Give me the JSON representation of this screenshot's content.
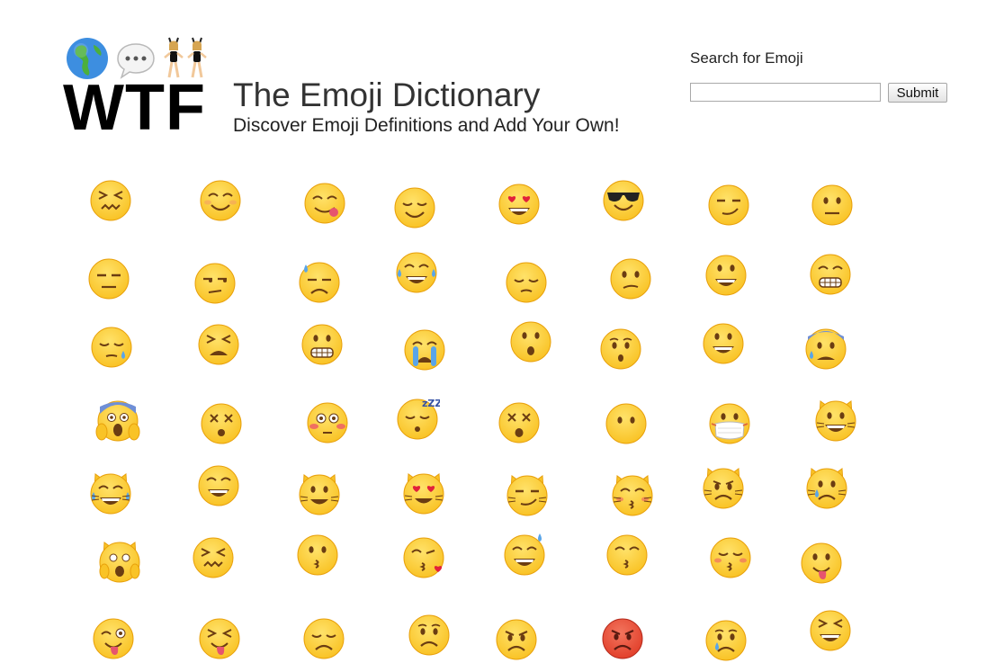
{
  "header": {
    "logo_text": "WTF",
    "logo_icons": [
      "globe-icon",
      "speech-bubble-icon",
      "dancing-women-icon"
    ],
    "title": "The Emoji Dictionary",
    "tagline": "Discover Emoji Definitions and Add Your Own!"
  },
  "search": {
    "label": "Search for Emoji",
    "value": "",
    "placeholder": "",
    "submit_label": "Submit"
  },
  "colors": {
    "emoji_face": "#F9C326",
    "emoji_face_edge": "#E8A00B",
    "angry_face": "#E2402B",
    "heart": "#E2213A",
    "tear": "#5AA5E8",
    "text": "#222222"
  },
  "emoji_rows": [
    [
      "confounded-face",
      "smiling-face",
      "face-savoring-food",
      "relieved-face",
      "heart-eyes-face",
      "sunglasses-face",
      "smirking-face",
      "neutral-face"
    ],
    [
      "expressionless-face",
      "unamused-face",
      "downcast-sweat-face",
      "tears-of-joy-face",
      "pensive-face",
      "confused-face",
      "grinning-face",
      "grimacing-face"
    ],
    [
      "sleepy-face",
      "tired-face",
      "grimacing-face-2",
      "loudly-crying-face",
      "hushed-face",
      "hushed-face-2",
      "smiley-face",
      "anxious-sweat-face"
    ],
    [
      "screaming-face",
      "dizzy-face",
      "flushed-face",
      "sleeping-face",
      "astonished-dizzy-face",
      "no-mouth-face",
      "medical-mask-face",
      "grinning-cat"
    ],
    [
      "joy-cat",
      "smile-face",
      "smiley-cat",
      "heart-eyes-cat",
      "smirk-cat",
      "kissing-cat",
      "pouting-cat",
      "crying-cat"
    ],
    [
      "weary-cat",
      "confounded-face-2",
      "kissing-face",
      "kissing-heart-face",
      "sweat-smile-face",
      "kissing-smiling-eyes-face",
      "kissing-closed-eyes-face",
      "tongue-face"
    ],
    [
      "winking-tongue-face",
      "squinting-tongue-face",
      "disappointed-face",
      "worried-face",
      "angry-face",
      "pouting-face",
      "crying-face",
      "laughing-face"
    ]
  ]
}
